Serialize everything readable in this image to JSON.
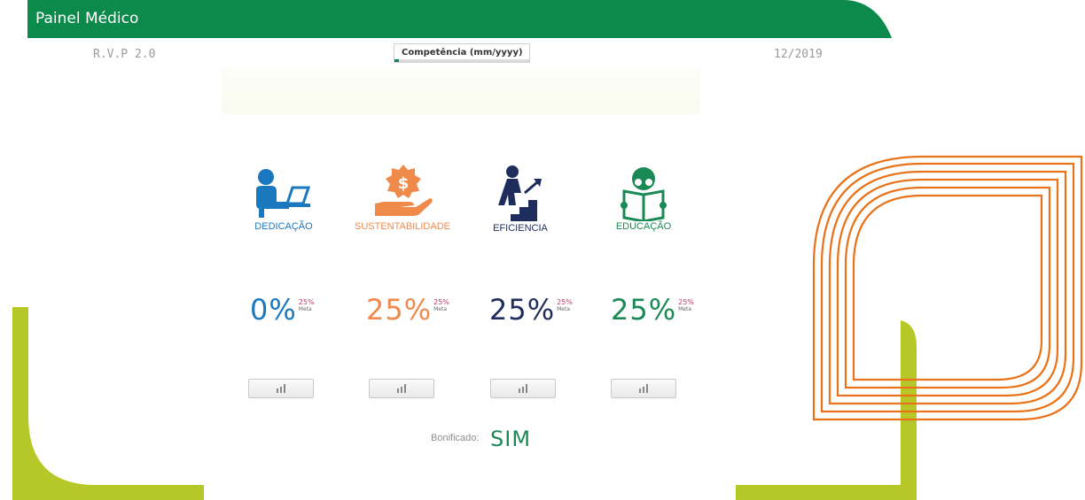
{
  "header": {
    "title": "Painel Médico"
  },
  "version": "R.V.P 2.0",
  "competencia": {
    "label": "Competência (mm/yyyy)",
    "progress": 0.03
  },
  "period": "12/2019",
  "pillars": [
    {
      "label": "DEDICAÇÃO",
      "icon": "person-laptop-icon",
      "value": "0%",
      "target": "25%",
      "meta": "Meta",
      "color": "#1a78bf"
    },
    {
      "label": "SUSTENTABILIDADE",
      "icon": "money-hand-icon",
      "value": "25%",
      "target": "25%",
      "meta": "Meta",
      "color": "#f08a4b"
    },
    {
      "label": "EFICIENCIA",
      "icon": "climbing-stairs-icon",
      "value": "25%",
      "target": "25%",
      "meta": "Meta",
      "color": "#1f2d5c"
    },
    {
      "label": "EDUCAÇÃO",
      "icon": "reading-person-icon",
      "value": "25%",
      "target": "25%",
      "meta": "Meta",
      "color": "#1a8a55"
    }
  ],
  "bonus": {
    "label": "Bonificado:",
    "value": "SIM"
  },
  "colors": {
    "brand_green": "#0b8a4b",
    "lime": "#b5c827",
    "orange": "#e8731a"
  }
}
